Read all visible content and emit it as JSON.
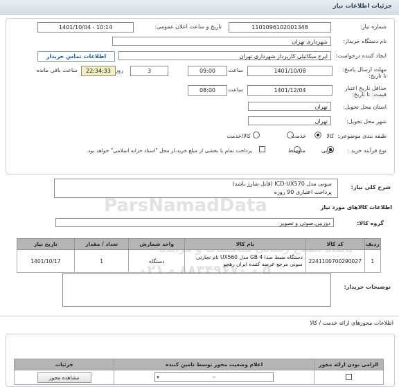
{
  "header": {
    "title": "جزئیات اطلاعات نیاز"
  },
  "form": {
    "need_number_label": "شماره نیاز:",
    "need_number": "1101096102001348",
    "announce_label": "تاریخ و ساعت اعلان عمومی:",
    "announce_value": "1401/10/04 - 10:14",
    "buyer_label": "نام دستگاه خریدار:",
    "buyer_value": "شهرداری تهران",
    "creator_label": "ایجاد کننده درخواست:",
    "creator_value": "ایرج میکائیلی کارپرداز شهرداری تهران",
    "contact_link": "اطلاعات تماس خریدار",
    "send_deadline_label": "مهلت ارسال پاسخ: تا تاریخ:",
    "send_date": "1401/10/08",
    "time_label": "ساعت",
    "send_time": "09:00",
    "days": "3",
    "days_label": "روز و",
    "remaining": "22:34:33",
    "remaining_label": "ساعت باقی مانده",
    "validity_label": "حداقل تاریخ اعتبار قیمت: تا تاریخ:",
    "validity_date": "1401/12/04",
    "validity_time": "08:00",
    "province_label": "استان محل تحویل:",
    "province_value": "تهران",
    "city_label": "شهر محل تحویل:",
    "city_value": "تهران",
    "category_label": "طبقه بندی موضوعی:",
    "category_options": [
      "کالا",
      "خدمت",
      "کالا/خدمت"
    ],
    "category_selected": "کالا",
    "process_label": "نوع فرآیند خرید :",
    "process_options": [
      "جزیی",
      "متوسط"
    ],
    "process_selected": "جزیی",
    "treasury_note": "پرداخت تمام یا بخشی از مبلغ خرید،از محل \"اسناد خزانه اسلامی\" خواهد بود."
  },
  "summary": {
    "label": "شرح کلی نیاز:",
    "line1": "سونی مدل ICD-UX570 (قابل شارژ باشد)",
    "line2": "پرداخت اعتباری 90 روزه"
  },
  "goods": {
    "section_title": "اطلاعات کالاهای مورد نیاز",
    "group_label": "گروه کالا:",
    "group_value": "دوربین،صوتی و تصویر",
    "columns": [
      "ردیف",
      "کد کالا",
      "نام کالا",
      "واحد شمارش",
      "تعداد / مقدار",
      "تاریخ نیاز"
    ],
    "rows": [
      {
        "index": "1",
        "code": "2241100700290027",
        "name": "دستگاه ضبط صدا 4 GB مدل UX560 نام تجارتی سونی مرجع عرضه کننده ایران رهجو",
        "unit": "دستگاه",
        "qty": "1",
        "date": "1401/10/17"
      }
    ]
  },
  "buyer_notes": {
    "label": "توضیحات خریدار:"
  },
  "provider": {
    "section_title": "اطلاعات مجوزهای ارائه خدمت / کالا",
    "columns": [
      "الزامی بودن ارائه مجوز",
      "اعلام وضعیت مجوز توسط تامین کننده",
      "جزئیات"
    ],
    "status_value": "--",
    "details_button": "مشاهده مجوز"
  },
  "watermark": {
    "brand": "ParsNamadData",
    "phone": "۰۲۱ - ۸۸۳۴۹۶۷۰ - ۵",
    "org": "پایگاه اطلاع رسانی مناقصات و مزایده"
  },
  "colors": {
    "header_bg": "#d5dde6",
    "link": "#1f5fa8",
    "remaining_bg": "#f2f0c2",
    "table_header": "#b5b5b5"
  }
}
